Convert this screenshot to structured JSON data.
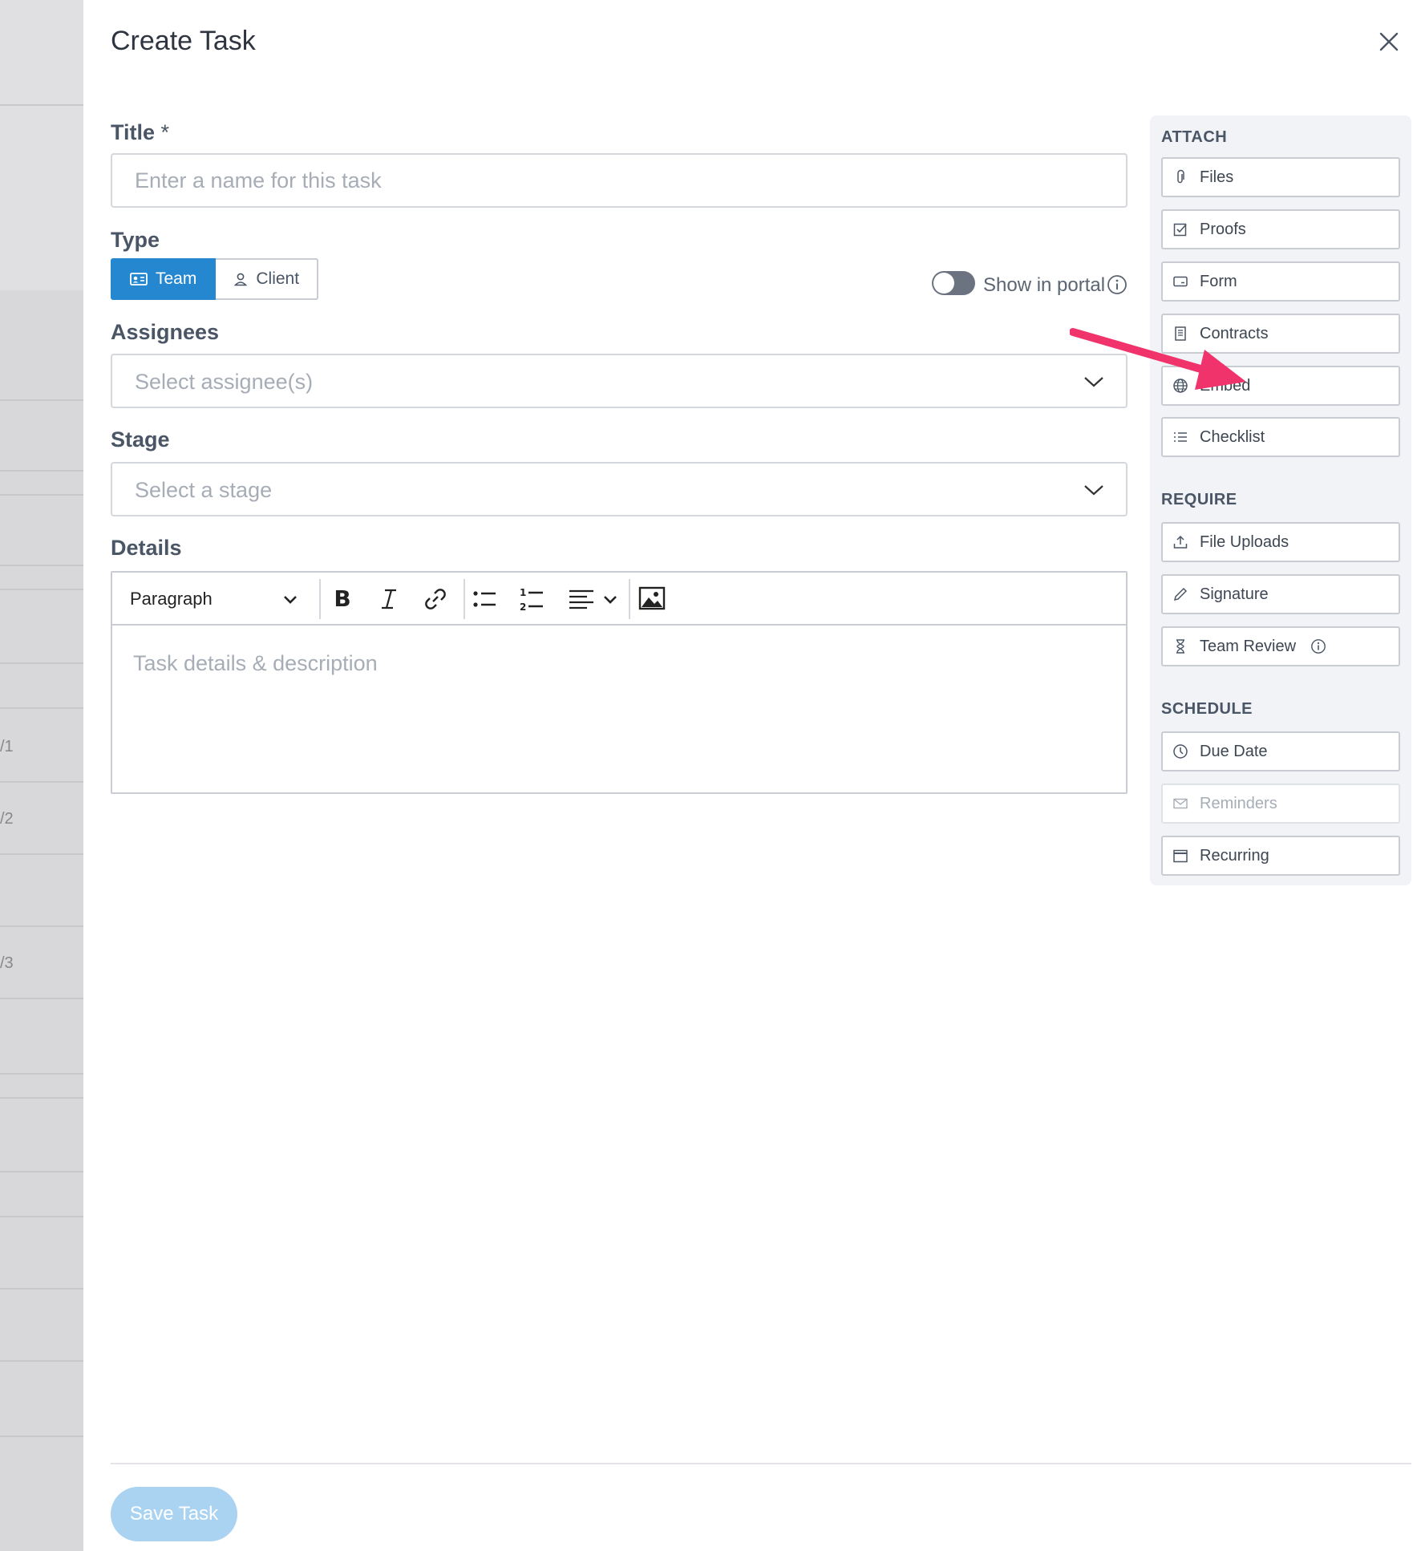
{
  "backdrop": {
    "row_numbers": [
      "/1",
      "/2",
      "/3"
    ]
  },
  "modal": {
    "title": "Create Task",
    "title_field": {
      "label": "Title",
      "required_mark": "*",
      "placeholder": "Enter a name for this task",
      "value": ""
    },
    "type_field": {
      "label": "Type",
      "options": [
        {
          "label": "Team",
          "icon": "id-card-icon",
          "selected": true
        },
        {
          "label": "Client",
          "icon": "person-icon",
          "selected": false
        }
      ]
    },
    "show_in_portal": {
      "label": "Show in portal",
      "enabled": false
    },
    "assignees_field": {
      "label": "Assignees",
      "placeholder": "Select assignee(s)"
    },
    "stage_field": {
      "label": "Stage",
      "placeholder": "Select a stage"
    },
    "details_field": {
      "label": "Details",
      "block_format": "Paragraph",
      "toolbar": [
        "bold-icon",
        "italic-icon",
        "link-icon",
        "bullet-list-icon",
        "numbered-list-icon",
        "align-left-icon",
        "image-icon"
      ],
      "placeholder": "Task details & description"
    },
    "sidebar": {
      "attach": {
        "heading": "ATTACH",
        "items": [
          {
            "label": "Files",
            "icon": "paperclip-icon"
          },
          {
            "label": "Proofs",
            "icon": "checkbox-icon"
          },
          {
            "label": "Form",
            "icon": "form-icon"
          },
          {
            "label": "Contracts",
            "icon": "document-icon"
          },
          {
            "label": "Embed",
            "icon": "globe-icon"
          },
          {
            "label": "Checklist",
            "icon": "checklist-icon"
          }
        ]
      },
      "require": {
        "heading": "REQUIRE",
        "items": [
          {
            "label": "File Uploads",
            "icon": "upload-icon"
          },
          {
            "label": "Signature",
            "icon": "pencil-icon"
          },
          {
            "label": "Team Review",
            "icon": "hourglass-icon"
          }
        ]
      },
      "schedule": {
        "heading": "SCHEDULE",
        "items": [
          {
            "label": "Due Date",
            "icon": "clock-icon"
          },
          {
            "label": "Reminders",
            "icon": "envelope-icon",
            "disabled": true
          },
          {
            "label": "Recurring",
            "icon": "calendar-icon"
          }
        ]
      }
    },
    "save_button": "Save Task"
  },
  "colors": {
    "primary": "#2587d0",
    "save_disabled": "#a9d3f1",
    "annotation_arrow": "#f0336b"
  }
}
